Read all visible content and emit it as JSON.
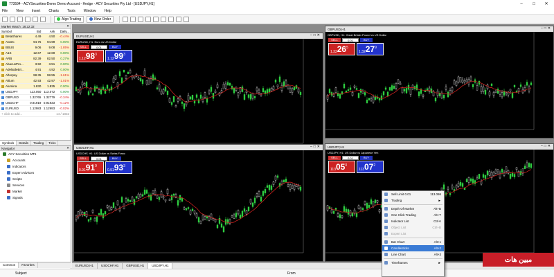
{
  "window": {
    "title": "773594 - ACYSecurities-Demo Demo Account - Hedge - ACY Securities Pty Ltd - [USDJPY,H1]"
  },
  "menu": [
    "File",
    "View",
    "Insert",
    "Charts",
    "Tools",
    "Window",
    "Help"
  ],
  "toolbar": {
    "algo_label": "Algo Trading",
    "neworder_label": "New Order"
  },
  "market_watch": {
    "title": "Market Watch: 18:22:32",
    "columns": [
      "Symbol",
      "Bid",
      "Ask",
      "Daily..."
    ],
    "rows": [
      {
        "sym": "BetaShares",
        "bid": "4.49",
        "ask": "4.50",
        "daily": "-0.44%",
        "hl": true
      },
      {
        "sym": "ACDC",
        "bid": "94.75",
        "ask": "94.99",
        "daily": "0.00%",
        "hl": true
      },
      {
        "sym": "BBUS",
        "bid": "9.06",
        "ask": "9.08",
        "daily": "-1.85%",
        "hl": true
      },
      {
        "sym": "A1S",
        "bid": "12.67",
        "ask": "12.69",
        "daily": "0.00%",
        "hl": true
      },
      {
        "sym": "ARB",
        "bid": "82.39",
        "ask": "82.50",
        "daily": "0.27%",
        "hl": true
      },
      {
        "sym": "AbacusPro...",
        "bid": "3.50",
        "ask": "3.51",
        "daily": "0.00%",
        "hl": true
      },
      {
        "sym": "AdelaideBri...",
        "bid": "4.91",
        "ask": "4.92",
        "daily": "0.00%",
        "hl": true
      },
      {
        "sym": "Afterpay",
        "bid": "98.35",
        "ask": "98.55",
        "daily": "-1.61%",
        "hl": true
      },
      {
        "sym": "Altium",
        "bid": "42.93",
        "ask": "42.97",
        "daily": "-1.01%",
        "hl": true
      },
      {
        "sym": "Alumina",
        "bid": "1.830",
        "ask": "1.835",
        "daily": "0.00%",
        "hl": true
      },
      {
        "sym": "USDJPY",
        "bid": "113.050",
        "ask": "113.072",
        "daily": "0.00%",
        "hl": false
      },
      {
        "sym": "GBPUSD",
        "bid": "1.32765",
        "ask": "1.32779",
        "daily": "-0.34%",
        "hl": false
      },
      {
        "sym": "USDCHF",
        "bid": "0.91919",
        "ask": "0.91933",
        "daily": "-0.12%",
        "hl": false
      },
      {
        "sym": "EURUSD",
        "bid": "1.12983",
        "ask": "1.12993",
        "daily": "-0.02%",
        "hl": false
      }
    ],
    "add_label": "+ click to add...",
    "count": "14 / 1832",
    "tabs": [
      "Symbols",
      "Details",
      "Trading",
      "Ticks"
    ]
  },
  "navigator": {
    "title": "Navigator",
    "items": [
      {
        "label": "ACY Securities MT5",
        "sub": false,
        "color": "#2a7a2a"
      },
      {
        "label": "Accounts",
        "sub": true,
        "color": "#c9a227"
      },
      {
        "label": "Indicators",
        "sub": true,
        "color": "#3a6ec8"
      },
      {
        "label": "Expert Advisors",
        "sub": true,
        "color": "#3a6ec8"
      },
      {
        "label": "Scripts",
        "sub": true,
        "color": "#3a6ec8"
      },
      {
        "label": "Services",
        "sub": true,
        "color": "#888888"
      },
      {
        "label": "Market",
        "sub": true,
        "color": "#c03030"
      },
      {
        "label": "Signals",
        "sub": true,
        "color": "#3a6ec8"
      }
    ],
    "tabs": [
      "Common",
      "Favorites"
    ]
  },
  "charts": [
    {
      "tab": "EURUSD,H1",
      "title": "EURUSD, H1: Euro vs US Dollar",
      "lot": "0.01",
      "sell_big": "98",
      "sell_sup": "3",
      "sell_pre": "1.12",
      "buy_big": "99",
      "buy_sup": "3",
      "buy_pre": "1.12",
      "sell": "SELL",
      "buy": "BUY"
    },
    {
      "tab": "GBPUSD,H1",
      "title": "GBPUSD, H1: Great Britain Pound vs US Dollar",
      "lot": "0.01",
      "sell_big": "26",
      "sell_sup": "5",
      "sell_pre": "1.32",
      "buy_big": "27",
      "buy_sup": "9",
      "buy_pre": "1.32",
      "sell": "SELL",
      "buy": "BUY"
    },
    {
      "tab": "USDCHF,H1",
      "title": "USDCHF, H1: US Dollar vs Swiss Franc",
      "lot": "0.01",
      "sell_big": "91",
      "sell_sup": "9",
      "sell_pre": "0.91",
      "buy_big": "93",
      "buy_sup": "3",
      "buy_pre": "0.91",
      "sell": "SELL",
      "buy": "BUY"
    },
    {
      "tab": "USDJPY,H1",
      "title": "USDJPY, H1: US Dollar vs Japanese Yen",
      "lot": "0.01",
      "sell_big": "05",
      "sell_sup": "0",
      "sell_pre": "113",
      "buy_big": "07",
      "buy_sup": "2",
      "buy_pre": "113",
      "sell": "SELL",
      "buy": "BUY"
    }
  ],
  "chart_tabs": [
    "EURUSD,H1",
    "USDCHF,H1",
    "GBPUSD,H1",
    "USDJPY,H1"
  ],
  "context_menu": [
    {
      "label": "Sell Limit 0.01",
      "key": "113.086",
      "dis": false
    },
    {
      "label": "Trading",
      "key": "►",
      "dis": false
    },
    {
      "sep": true
    },
    {
      "label": "Depth Of Market",
      "key": "Alt+B",
      "dis": false
    },
    {
      "label": "One Click Trading",
      "key": "Alt+T",
      "dis": false
    },
    {
      "label": "Indicator List",
      "key": "Ctrl+I",
      "dis": false
    },
    {
      "label": "Object List",
      "key": "Ctrl+B",
      "dis": true
    },
    {
      "label": "Expert List",
      "key": "",
      "dis": true
    },
    {
      "sep": true
    },
    {
      "label": "Bar Chart",
      "key": "Alt+1",
      "dis": false
    },
    {
      "label": "Candlesticks",
      "key": "Alt+2",
      "dis": false,
      "sel": true
    },
    {
      "label": "Line Chart",
      "key": "Alt+3",
      "dis": false
    },
    {
      "sep": true
    },
    {
      "label": "Timeframes",
      "key": "►",
      "dis": false
    }
  ],
  "status": {
    "subject": "Subject",
    "from": "From"
  },
  "watermark": "مبین هات",
  "colors": {
    "bull": "#2ecc40",
    "bear": "#ffffff",
    "ma": "#c8201e",
    "chart_bg": "#000000"
  }
}
